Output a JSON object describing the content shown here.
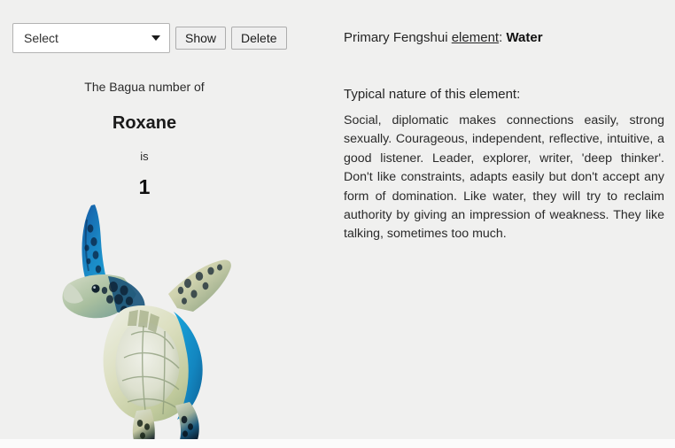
{
  "toolbar": {
    "select": {
      "selected": "Select",
      "options": [
        "Select"
      ],
      "arrow_icon": "chevron-down-icon"
    },
    "show_label": "Show",
    "delete_label": "Delete"
  },
  "bagua": {
    "intro": "The Bagua number of",
    "name": "Roxane",
    "connector": "is",
    "number": "1"
  },
  "animal": {
    "alt": "sea-turtle-photo",
    "name": "sea turtle",
    "colors": {
      "flipper_blue": "#1b9fd0",
      "deep_blue": "#0d3a6b",
      "shell_cream": "#d8d9b8",
      "shell_green": "#9fb48a",
      "pale": "#e8ecec"
    }
  },
  "element_panel": {
    "prefix": "Primary Fengshui ",
    "link_text": "element",
    "separator": ": ",
    "value": "Water",
    "nature_heading": "Typical nature of this element:",
    "nature_body": "Social, diplomatic makes connections easily, strong sexually. Courageous, independent, reflective, intuitive, a good listener. Leader, explorer, writer, 'deep thinker'. Don't like constraints, adapts easily but don't accept any form of domination. Like water, they will try to reclaim authority by giving an impression of weakness. They like talking, sometimes too much."
  },
  "theme": {
    "page_background": "#f0f0ef",
    "text_color": "#262626",
    "button_background": "#efefef",
    "button_border": "#adadad",
    "input_background": "#ffffff",
    "input_border": "#b3b3b3"
  }
}
